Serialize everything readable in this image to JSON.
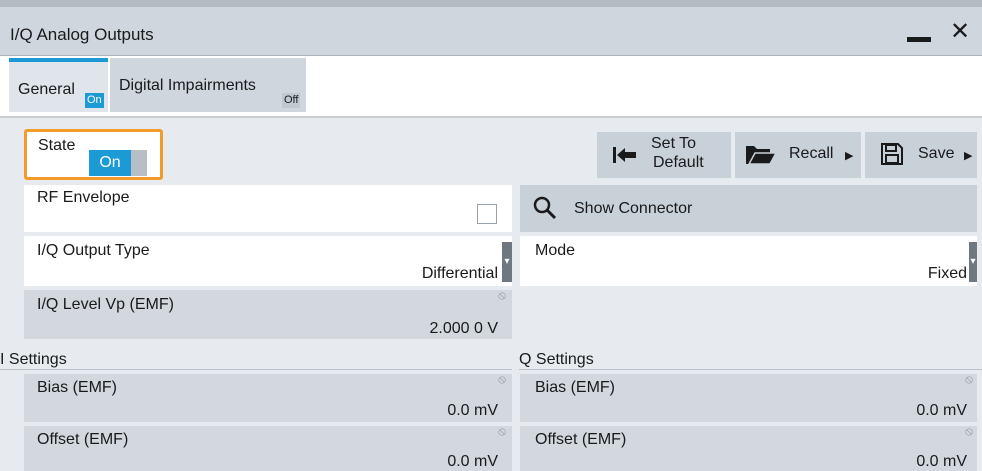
{
  "window": {
    "title": "I/Q Analog Outputs"
  },
  "tabs": [
    {
      "label": "General",
      "badge": "On"
    },
    {
      "label": "Digital Impairments",
      "badge": "Off"
    }
  ],
  "state": {
    "label": "State",
    "value": "On"
  },
  "toolbar": {
    "set_default_line1": "Set To",
    "set_default_line2": "Default",
    "recall_label": "Recall",
    "save_label": "Save"
  },
  "rf_envelope": {
    "label": "RF Envelope"
  },
  "show_connector": {
    "label": "Show Connector"
  },
  "iq_output_type": {
    "label": "I/Q Output Type",
    "value": "Differential"
  },
  "mode": {
    "label": "Mode",
    "value": "Fixed"
  },
  "iq_level": {
    "label": "I/Q Level Vp (EMF)",
    "value": "2.000 0 V"
  },
  "i_settings": {
    "heading": "I Settings",
    "bias_label": "Bias (EMF)",
    "bias_value": "0.0 mV",
    "offset_label": "Offset (EMF)",
    "offset_value": "0.0 mV"
  },
  "q_settings": {
    "heading": "Q Settings",
    "bias_label": "Bias (EMF)",
    "bias_value": "0.0 mV",
    "offset_label": "Offset (EMF)",
    "offset_value": "0.0 mV"
  },
  "colors": {
    "accent": "#1b9ad6",
    "focus": "#f29b2d",
    "panel": "#e7ebef",
    "titlebar": "#cfd6de"
  }
}
